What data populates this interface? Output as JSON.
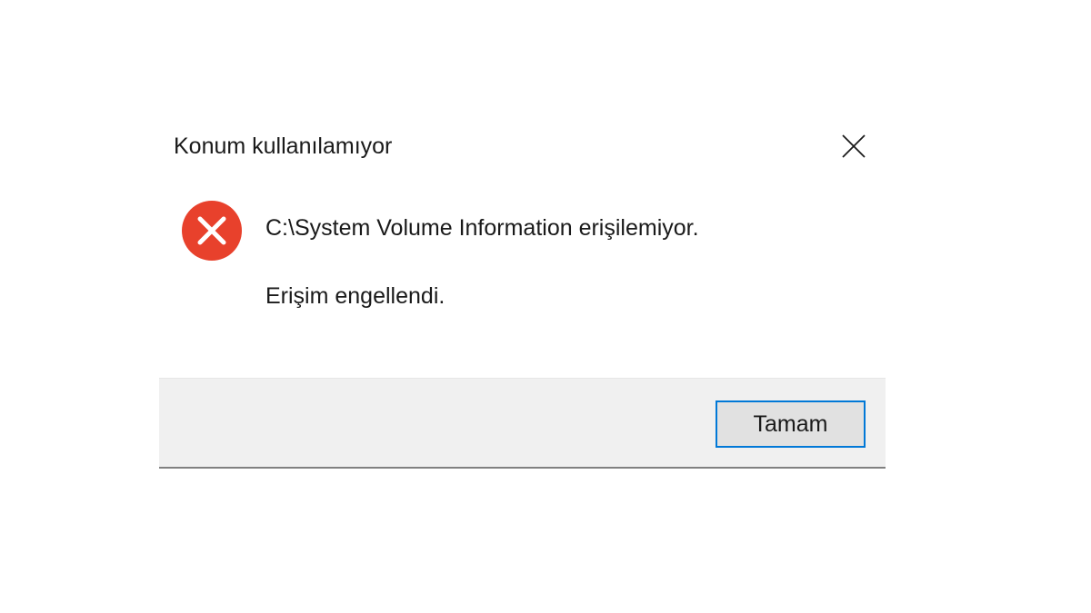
{
  "dialog": {
    "title": "Konum kullanılamıyor",
    "close_icon": "close-icon",
    "error_icon": "error-icon",
    "message": "C:\\System Volume Information erişilemiyor.",
    "detail": "Erişim engellendi.",
    "ok_label": "Tamam"
  },
  "colors": {
    "error_red": "#e8412c",
    "button_accent": "#0078d7",
    "footer_bg": "#f0f0f0"
  }
}
